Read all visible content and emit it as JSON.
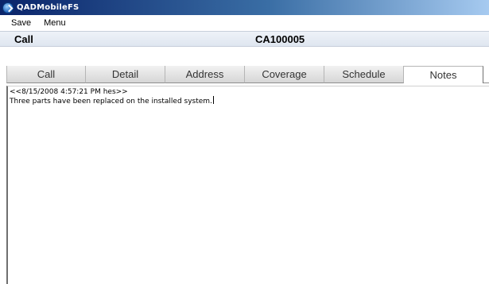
{
  "window": {
    "title": "QADMobileFS",
    "icon": "app-arrow-icon"
  },
  "menu": {
    "items": [
      {
        "label": "Save"
      },
      {
        "label": "Menu"
      }
    ]
  },
  "header": {
    "section": "Call",
    "record_id": "CA100005"
  },
  "tabs": [
    {
      "label": "Call",
      "active": false
    },
    {
      "label": "Detail",
      "active": false
    },
    {
      "label": "Address",
      "active": false
    },
    {
      "label": "Coverage",
      "active": false
    },
    {
      "label": "Schedule",
      "active": false
    },
    {
      "label": "Notes",
      "active": true
    }
  ],
  "notes": {
    "lines": [
      "<<8/15/2008 4:57:21 PM hes>>",
      "Three parts have been replaced on the installed system."
    ]
  },
  "colors": {
    "titlebar_start": "#0a246a",
    "titlebar_end": "#a6caf0",
    "header_bg": "#dfe6f0"
  }
}
